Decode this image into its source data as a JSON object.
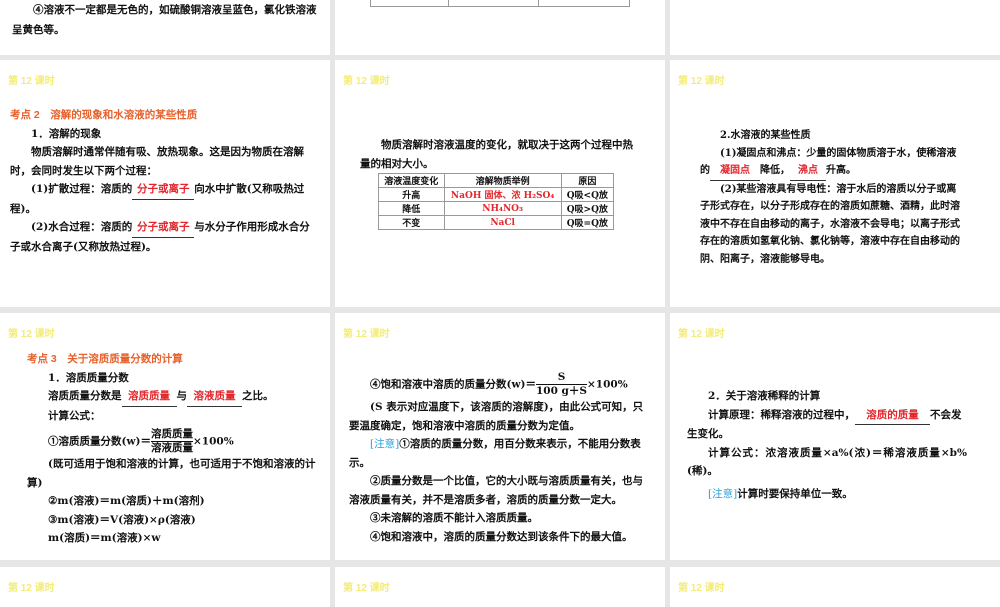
{
  "slide_header": "第 12 课时",
  "s0": {
    "text": "④溶液不一定都是无色的，如硫酸铜溶液呈蓝色，氯化铁溶液呈黄色等。"
  },
  "s1": {
    "title": "考点 2　溶解的现象和水溶液的某些性质",
    "h1": "1．溶解的现象",
    "p1": "物质溶解时通常伴随有吸、放热现象。这是因为物质在溶解时，会同时发生以下两个过程：",
    "p2a": "(1)扩散过程：溶质的",
    "p2blank": "分子或离子",
    "p2b": "向水中扩散(又称吸热过程)。",
    "p3a": "(2)水合过程：溶质的",
    "p3blank": "分子或离子",
    "p3b": "与水分子作用形成水合分子或水合离子(又称放热过程)。"
  },
  "s2": {
    "p1": "物质溶解时溶液温度的变化，就取决于这两个过程中热量的相对大小。",
    "table": {
      "headers": [
        "溶液温度变化",
        "溶解物质举例",
        "原因"
      ],
      "rows": [
        [
          "升高",
          "NaOH 固体、浓 H₂SO₄",
          "Q吸<Q放"
        ],
        [
          "降低",
          "NH₄NO₃",
          "Q吸>Q放"
        ],
        [
          "不变",
          "NaCl",
          "Q吸=Q放"
        ]
      ]
    }
  },
  "s3": {
    "h1": "2.水溶液的某些性质",
    "p1a": "(1)凝固点和沸点：少量的固体物质溶于水，使稀溶液的",
    "b1": "凝固点",
    "p1b": "降低，",
    "b2": "沸点",
    "p1c": "升高。",
    "p2": "(2)某些溶液具有导电性：溶于水后的溶质以分子或离子形式存在，以分子形成存在的溶质如蔗糖、酒精，此时溶液中不存在自由移动的离子，水溶液不会导电；以离子形式存在的溶质如氢氧化钠、氯化钠等，溶液中存在自由移动的阴、阳离子，溶液能够导电。"
  },
  "s4": {
    "title": "考点 3　关于溶质质量分数的计算",
    "h1": "1．溶质质量分数",
    "p1a": "溶质质量分数是",
    "b1": "溶质质量",
    "p1b": "与",
    "b2": "溶液质量",
    "p1c": "之比。",
    "p2": "计算公式：",
    "f1a": "①溶质质量分数(w)＝",
    "f1num": "溶质质量",
    "f1den": "溶液质量",
    "f1b": "×100%",
    "p3": "(既可适用于饱和溶液的计算，也可适用于不饱和溶液的计算)",
    "f2": "②m(溶液)＝m(溶质)＋m(溶剂)",
    "f3": "③m(溶液)＝V(溶液)×ρ(溶液)",
    "f4": "m(溶质)＝m(溶液)×w"
  },
  "s5": {
    "f1a": "④饱和溶液中溶质的质量分数(w)＝",
    "f1num": "S",
    "f1den": "100 g＋S",
    "f1b": "×100%",
    "p1": "(S 表示对应温度下，该溶质的溶解度)，由此公式可知，只要温度确定，饱和溶液中溶质的质量分数为定值。",
    "note": "[注意]",
    "n1": "①溶质的质量分数，用百分数来表示，不能用分数表示。",
    "n2": "②质量分数是一个比值，它的大小既与溶质质量有关，也与溶液质量有关，并不是溶质多者，溶质的质量分数一定大。",
    "n3": "③未溶解的溶质不能计入溶质质量。",
    "n4": "④饱和溶液中，溶质的质量分数达到该条件下的最大值。"
  },
  "s6": {
    "h1": "2．关于溶液稀释的计算",
    "p1a": "计算原理：稀释溶液的过程中，",
    "b1": "溶质的质量",
    "p1b": "不会发生变化。",
    "p2": "计算公式：浓溶液质量×a%(浓)＝稀溶液质量×b%(稀)。",
    "note": "[注意]",
    "n1": "计算时要保持单位一致。"
  }
}
